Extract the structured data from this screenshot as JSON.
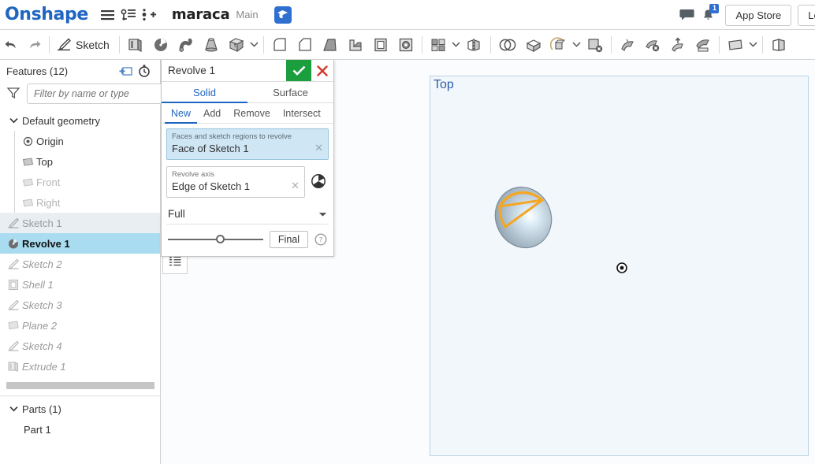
{
  "header": {
    "logo": "Onshape",
    "menu_icon": "hamburger-icon",
    "version_tree_icon": "version-tree-icon",
    "branch_icon": "add-version-icon",
    "document_title": "maraca",
    "workspace": "Main",
    "edu_badge_icon": "graduation-cap-icon",
    "comments_icon": "comment-bubble-icon",
    "notifications_icon": "bell-icon",
    "notification_count": "1",
    "app_store_label": "App Store",
    "learning_label": "Lea"
  },
  "toolbar": {
    "undo_label": "Undo",
    "redo_label": "Redo",
    "sketch_label": "Sketch",
    "items": [
      {
        "name": "undo-icon",
        "label": "Undo"
      },
      {
        "name": "redo-icon",
        "label": "Redo"
      },
      {
        "name": "sketch-tool",
        "label": "Sketch"
      },
      {
        "name": "extrude-tool",
        "label": "Extrude"
      },
      {
        "name": "revolve-tool",
        "label": "Revolve"
      },
      {
        "name": "sweep-tool",
        "label": "Sweep"
      },
      {
        "name": "loft-tool",
        "label": "Loft"
      },
      {
        "name": "thicken-tool",
        "label": "Thicken"
      },
      {
        "name": "fillet-tool",
        "label": "Fillet"
      },
      {
        "name": "chamfer-tool",
        "label": "Chamfer"
      },
      {
        "name": "draft-tool",
        "label": "Draft"
      },
      {
        "name": "rib-tool",
        "label": "Rib"
      },
      {
        "name": "shell-tool",
        "label": "Shell"
      },
      {
        "name": "hole-tool",
        "label": "Hole"
      },
      {
        "name": "pattern-tool",
        "label": "Pattern"
      },
      {
        "name": "mirror-tool",
        "label": "Mirror"
      },
      {
        "name": "boolean-tool",
        "label": "Boolean"
      },
      {
        "name": "split-tool",
        "label": "Split"
      },
      {
        "name": "transform-tool",
        "label": "Transform"
      },
      {
        "name": "delete-part-tool",
        "label": "Delete part"
      },
      {
        "name": "enclose-tool",
        "label": "Enclose"
      },
      {
        "name": "delete-face-tool",
        "label": "Delete face"
      },
      {
        "name": "move-face-tool",
        "label": "Move face"
      },
      {
        "name": "replace-face-tool",
        "label": "Replace face"
      },
      {
        "name": "plane-tool",
        "label": "Plane"
      },
      {
        "name": "sheet-metal-tool",
        "label": "Sheet metal"
      }
    ]
  },
  "features_panel": {
    "title": "Features (12)",
    "add_feature_icon": "add-feature-icon",
    "history_icon": "feature-history-icon",
    "filter_icon": "filter-funnel-icon",
    "filter_placeholder": "Filter by name or type",
    "filter_value": "",
    "tree": [
      {
        "label": "Default geometry",
        "type": "group",
        "icon": "chevron-down-icon",
        "state": "expanded"
      },
      {
        "label": "Origin",
        "type": "child",
        "icon": "origin-icon",
        "state": "normal"
      },
      {
        "label": "Top",
        "type": "child",
        "icon": "plane-icon",
        "state": "normal"
      },
      {
        "label": "Front",
        "type": "child",
        "icon": "plane-icon",
        "state": "dim"
      },
      {
        "label": "Right",
        "type": "child",
        "icon": "plane-icon",
        "state": "dim"
      },
      {
        "label": "Sketch 1",
        "type": "feature",
        "icon": "sketch-icon",
        "state": "sel-light"
      },
      {
        "label": "Revolve 1",
        "type": "feature",
        "icon": "revolve-icon",
        "state": "sel-active"
      },
      {
        "label": "Sketch 2",
        "type": "feature",
        "icon": "sketch-icon",
        "state": "rolled"
      },
      {
        "label": "Shell 1",
        "type": "feature",
        "icon": "shell-icon",
        "state": "rolled"
      },
      {
        "label": "Sketch 3",
        "type": "feature",
        "icon": "sketch-icon",
        "state": "rolled"
      },
      {
        "label": "Plane 2",
        "type": "feature",
        "icon": "plane-icon",
        "state": "rolled"
      },
      {
        "label": "Sketch 4",
        "type": "feature",
        "icon": "sketch-icon",
        "state": "rolled"
      },
      {
        "label": "Extrude 1",
        "type": "feature",
        "icon": "extrude-icon",
        "state": "rolled"
      }
    ],
    "parts": {
      "title": "Parts (1)",
      "chevron_icon": "chevron-down-icon",
      "items": [
        "Part 1"
      ]
    }
  },
  "dialog": {
    "title": "Revolve 1",
    "accept_icon": "checkmark-icon",
    "cancel_icon": "close-x-icon",
    "tabs": [
      {
        "label": "Solid",
        "active": true
      },
      {
        "label": "Surface",
        "active": false
      }
    ],
    "subtabs": [
      {
        "label": "New",
        "active": true
      },
      {
        "label": "Add",
        "active": false
      },
      {
        "label": "Remove",
        "active": false
      },
      {
        "label": "Intersect",
        "active": false
      }
    ],
    "faces_field": {
      "label": "Faces and sketch regions to revolve",
      "value": "Face of Sketch 1",
      "clear_icon": "clear-x-icon"
    },
    "axis_field": {
      "label": "Revolve axis",
      "value": "Edge of Sketch 1",
      "clear_icon": "clear-x-icon"
    },
    "flip_icon": "revolve-direction-icon",
    "extent": {
      "value": "Full",
      "chevron_icon": "chevron-down-icon"
    },
    "slider_value": 55,
    "final_button": "Final",
    "help_icon": "help-question-icon",
    "list_toggle_icon": "feature-list-icon"
  },
  "viewport": {
    "plane_label": "Top",
    "origin_marker_icon": "origin-point-icon",
    "model_name": "revolve-preview-sphere"
  },
  "colors": {
    "brand_blue": "#1f66c1",
    "accent_blue": "#2f6fd0",
    "selection_blue": "#a9dcf0",
    "ok_green": "#1a9e3e",
    "cancel_red": "#d33a2c",
    "highlight_orange": "#f5a623",
    "plane_fill": "#f2f7fb",
    "plane_border": "#b9d2e4"
  }
}
